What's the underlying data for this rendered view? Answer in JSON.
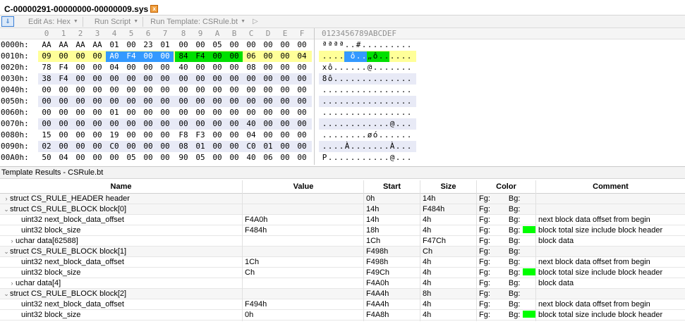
{
  "tab": {
    "title": "C-00000291-00000000-00000009.sys",
    "close_label": "x"
  },
  "toolbar": {
    "edit_as": "Edit As: Hex",
    "run_script": "Run Script",
    "run_template": "Run Template: CSRule.bt"
  },
  "hex": {
    "columns": [
      "0",
      "1",
      "2",
      "3",
      "4",
      "5",
      "6",
      "7",
      "8",
      "9",
      "A",
      "B",
      "C",
      "D",
      "E",
      "F"
    ],
    "ascii_header": "0123456789ABCDEF",
    "rows": [
      {
        "addr": "0000h:",
        "bytes": [
          "AA",
          "AA",
          "AA",
          "AA",
          "01",
          "00",
          "23",
          "01",
          "00",
          "00",
          "05",
          "00",
          "00",
          "00",
          "00",
          "00"
        ],
        "ascii": "ªªªª..#........."
      },
      {
        "addr": "0010h:",
        "bytes": [
          "09",
          "00",
          "00",
          "00",
          "A0",
          "F4",
          "00",
          "00",
          "84",
          "F4",
          "00",
          "00",
          "06",
          "00",
          "00",
          "04"
        ],
        "ascii": ".... ô..„ô......"
      },
      {
        "addr": "0020h:",
        "bytes": [
          "78",
          "F4",
          "00",
          "00",
          "04",
          "00",
          "00",
          "00",
          "40",
          "00",
          "00",
          "00",
          "08",
          "00",
          "00",
          "00"
        ],
        "ascii": "xô......@......."
      },
      {
        "addr": "0030h:",
        "bytes": [
          "38",
          "F4",
          "00",
          "00",
          "00",
          "00",
          "00",
          "00",
          "00",
          "00",
          "00",
          "00",
          "00",
          "00",
          "00",
          "00"
        ],
        "ascii": "8ô.............."
      },
      {
        "addr": "0040h:",
        "bytes": [
          "00",
          "00",
          "00",
          "00",
          "00",
          "00",
          "00",
          "00",
          "00",
          "00",
          "00",
          "00",
          "00",
          "00",
          "00",
          "00"
        ],
        "ascii": "................"
      },
      {
        "addr": "0050h:",
        "bytes": [
          "00",
          "00",
          "00",
          "00",
          "00",
          "00",
          "00",
          "00",
          "00",
          "00",
          "00",
          "00",
          "00",
          "00",
          "00",
          "00"
        ],
        "ascii": "................"
      },
      {
        "addr": "0060h:",
        "bytes": [
          "00",
          "00",
          "00",
          "00",
          "01",
          "00",
          "00",
          "00",
          "00",
          "00",
          "00",
          "00",
          "00",
          "00",
          "00",
          "00"
        ],
        "ascii": "................"
      },
      {
        "addr": "0070h:",
        "bytes": [
          "00",
          "00",
          "00",
          "00",
          "00",
          "00",
          "00",
          "00",
          "00",
          "00",
          "00",
          "00",
          "40",
          "00",
          "00",
          "00"
        ],
        "ascii": "............@..."
      },
      {
        "addr": "0080h:",
        "bytes": [
          "15",
          "00",
          "00",
          "00",
          "19",
          "00",
          "00",
          "00",
          "F8",
          "F3",
          "00",
          "00",
          "04",
          "00",
          "00",
          "00"
        ],
        "ascii": "........øó......"
      },
      {
        "addr": "0090h:",
        "bytes": [
          "02",
          "00",
          "00",
          "00",
          "C0",
          "00",
          "00",
          "00",
          "08",
          "01",
          "00",
          "00",
          "C0",
          "01",
          "00",
          "00"
        ],
        "ascii": "....À.......À..."
      },
      {
        "addr": "00A0h:",
        "bytes": [
          "50",
          "04",
          "00",
          "00",
          "00",
          "05",
          "00",
          "00",
          "90",
          "05",
          "00",
          "00",
          "40",
          "06",
          "00",
          "00"
        ],
        "ascii": "P...........@..."
      }
    ]
  },
  "template_results": {
    "title": "Template Results - CSRule.bt"
  },
  "grid": {
    "headers": {
      "name": "Name",
      "value": "Value",
      "start": "Start",
      "size": "Size",
      "color": "Color",
      "comment": "Comment"
    },
    "rows": [
      {
        "name": "struct CS_RULE_HEADER header",
        "value": "",
        "start": "0h",
        "size": "14h",
        "fg": "Fg:",
        "bg": "Bg:",
        "swatch": false,
        "comment": "",
        "indent": 0,
        "chev": "›"
      },
      {
        "name": "struct CS_RULE_BLOCK block[0]",
        "value": "",
        "start": "14h",
        "size": "F484h",
        "fg": "Fg:",
        "bg": "Bg:",
        "swatch": false,
        "comment": "",
        "indent": 0,
        "chev": "⌄"
      },
      {
        "name": "uint32 next_block_data_offset",
        "value": "F4A0h",
        "start": "14h",
        "size": "4h",
        "fg": "Fg:",
        "bg": "Bg:",
        "swatch": false,
        "comment": "next block data offset from begin",
        "indent": 2,
        "chev": ""
      },
      {
        "name": "uint32 block_size",
        "value": "F484h",
        "start": "18h",
        "size": "4h",
        "fg": "Fg:",
        "bg": "Bg:",
        "swatch": true,
        "comment": "block total size include block header",
        "indent": 2,
        "chev": ""
      },
      {
        "name": "uchar data[62588]",
        "value": "",
        "start": "1Ch",
        "size": "F47Ch",
        "fg": "Fg:",
        "bg": "Bg:",
        "swatch": false,
        "comment": "block data",
        "indent": 1,
        "chev": "›"
      },
      {
        "name": "struct CS_RULE_BLOCK block[1]",
        "value": "",
        "start": "F498h",
        "size": "Ch",
        "fg": "Fg:",
        "bg": "Bg:",
        "swatch": false,
        "comment": "",
        "indent": 0,
        "chev": "⌄"
      },
      {
        "name": "uint32 next_block_data_offset",
        "value": "1Ch",
        "start": "F498h",
        "size": "4h",
        "fg": "Fg:",
        "bg": "Bg:",
        "swatch": false,
        "comment": "next block data offset from begin",
        "indent": 2,
        "chev": ""
      },
      {
        "name": "uint32 block_size",
        "value": "Ch",
        "start": "F49Ch",
        "size": "4h",
        "fg": "Fg:",
        "bg": "Bg:",
        "swatch": true,
        "comment": "block total size include block header",
        "indent": 2,
        "chev": ""
      },
      {
        "name": "uchar data[4]",
        "value": "",
        "start": "F4A0h",
        "size": "4h",
        "fg": "Fg:",
        "bg": "Bg:",
        "swatch": false,
        "comment": "block data",
        "indent": 1,
        "chev": "›"
      },
      {
        "name": "struct CS_RULE_BLOCK block[2]",
        "value": "",
        "start": "F4A4h",
        "size": "8h",
        "fg": "Fg:",
        "bg": "Bg:",
        "swatch": false,
        "comment": "",
        "indent": 0,
        "chev": "⌄"
      },
      {
        "name": "uint32 next_block_data_offset",
        "value": "F494h",
        "start": "F4A4h",
        "size": "4h",
        "fg": "Fg:",
        "bg": "Bg:",
        "swatch": false,
        "comment": "next block data offset from begin",
        "indent": 2,
        "chev": ""
      },
      {
        "name": "uint32 block_size",
        "value": "0h",
        "start": "F4A8h",
        "size": "4h",
        "fg": "Fg:",
        "bg": "Bg:",
        "swatch": true,
        "comment": "block total size include block header",
        "indent": 2,
        "chev": ""
      }
    ]
  },
  "colors": {
    "selection_blue": "#3399ff",
    "highlight_green": "#00e000",
    "highlight_yellow": "#ffff99",
    "swatch_green": "#00ff00",
    "alt_row": "#e8eaf6"
  }
}
